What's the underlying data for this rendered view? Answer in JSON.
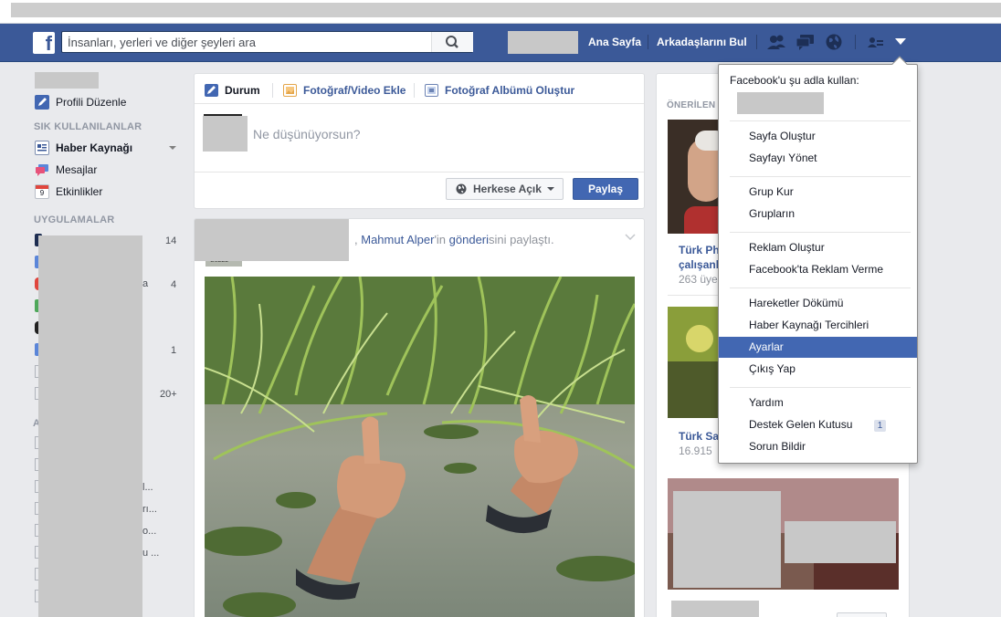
{
  "header": {
    "logo": "f",
    "search_placeholder": "İnsanları, yerleri ve diğer şeyleri ara",
    "nav_home": "Ana Sayfa",
    "nav_find_friends": "Arkadaşlarını Bul",
    "icons": [
      "friend-requests-icon",
      "messages-icon",
      "notifications-globe-icon",
      "privacy-shortcuts-icon",
      "account-menu-chevron-icon"
    ]
  },
  "sidebar": {
    "edit_profile": "Profili Düzenle",
    "favorites_heading": "SIK KULLANILANLAR",
    "favorites": [
      {
        "label": "Haber Kaynağı",
        "icon": "news-feed-icon",
        "bold": true
      },
      {
        "label": "Mesajlar",
        "icon": "messages-icon"
      },
      {
        "label": "Etkinlikler",
        "icon": "events-calendar-icon",
        "badge": "9"
      }
    ],
    "apps_heading": "UYGULAMALAR",
    "apps_counts": [
      "14",
      "4",
      "1",
      "20+"
    ],
    "apps_fragments": [
      "a",
      "l...",
      "rı...",
      "o...",
      "u ..."
    ],
    "third_heading_fragment": "A"
  },
  "composer": {
    "tabs": [
      {
        "label": "Durum",
        "icon": "status-pencil-icon"
      },
      {
        "label": "Fotoğraf/Video Ekle",
        "icon": "photo-video-icon"
      },
      {
        "label": "Fotoğraf Albümü Oluştur",
        "icon": "photo-album-icon"
      }
    ],
    "placeholder": "Ne düşünüyorsun?",
    "privacy_label": "Herkese Açık",
    "share_label": "Paylaş"
  },
  "post": {
    "author_link": "Mahmut Alper",
    "text_middle": "'in ",
    "post_link": "gönderi",
    "text_end": "sini paylaştı.",
    "avatar_caption": "GÜZEL"
  },
  "right": {
    "heading": "ÖNERİLEN G",
    "suggestions": [
      {
        "name_line1": "Türk Ph",
        "name_line2": "çalışanl",
        "sub": "263 üye"
      },
      {
        "name_line1": "Türk Sa",
        "sub": "16.915 "
      }
    ]
  },
  "account_menu": {
    "title": "Facebook'u şu adla kullan:",
    "groups": [
      [
        "Sayfa Oluştur",
        "Sayfayı Yönet"
      ],
      [
        "Grup Kur",
        "Grupların"
      ],
      [
        "Reklam Oluştur",
        "Facebook'ta Reklam Verme"
      ],
      [
        "Hareketler Dökümü",
        "Haber Kaynağı Tercihleri",
        "Ayarlar",
        "Çıkış Yap"
      ],
      [
        "Yardım",
        "Destek Gelen Kutusu",
        "Sorun Bildir"
      ]
    ],
    "active_item": "Ayarlar",
    "support_badge": "1"
  },
  "colors": {
    "topbar": "#3b5998",
    "link": "#3b5998",
    "menu_highlight": "#4267b2",
    "page_bg": "#e9eaed"
  }
}
